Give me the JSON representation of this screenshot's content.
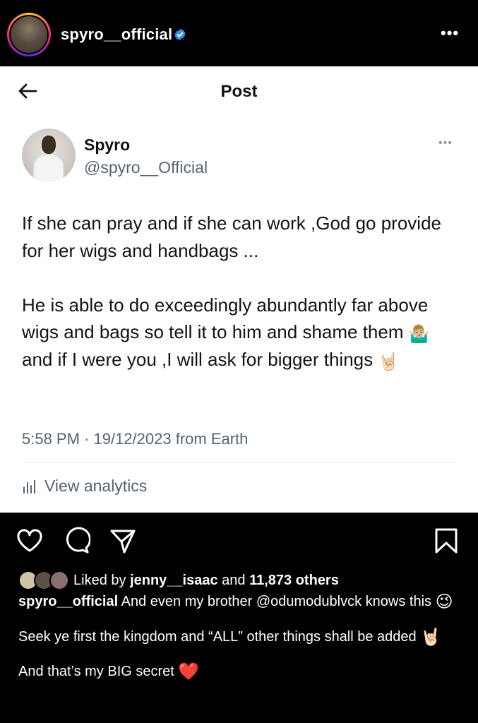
{
  "instagram": {
    "username": "spyro__official",
    "verified_icon": "verified-badge-icon",
    "more_label": "•••",
    "actions": [
      "heart-icon",
      "comment-icon",
      "share-icon",
      "bookmark-icon"
    ],
    "likes": {
      "prefix": "Liked by",
      "user": "jenny__isaac",
      "middle": "and",
      "others": "11,873 others"
    },
    "caption": {
      "username": "spyro__official",
      "line1": "And even my brother @odumodublvck knows this",
      "line1_emoji": "😉",
      "line2": "Seek ye first the kingdom and “ALL” other things shall be added",
      "line2_emoji": "🤘🏻",
      "line3": "And that’s my BIG secret",
      "line3_emoji": "❤️"
    }
  },
  "tweet": {
    "header_title": "Post",
    "author_name": "Spyro",
    "author_handle": "@spyro__Official",
    "more_label": "•••",
    "paragraph1": "If she can pray  and if she can work ,God go provide for her wigs and handbags ...",
    "paragraph2_a": "He is able to do exceedingly abundantly far above wigs and bags so tell it to him and shame them",
    "paragraph2_emoji1": "🤷🏼‍♂️",
    "paragraph2_b": "and if I were you ,I will ask for bigger things",
    "paragraph2_emoji2": "🤘🏻",
    "timestamp": "5:58 PM · 19/12/2023 from Earth",
    "analytics_label": "View analytics"
  },
  "colors": {
    "ig_background": "#000000",
    "tweet_background": "#ffffff",
    "secondary_text": "#536471",
    "verified_blue": "#3897f0",
    "heart_red": "#e0245e"
  }
}
